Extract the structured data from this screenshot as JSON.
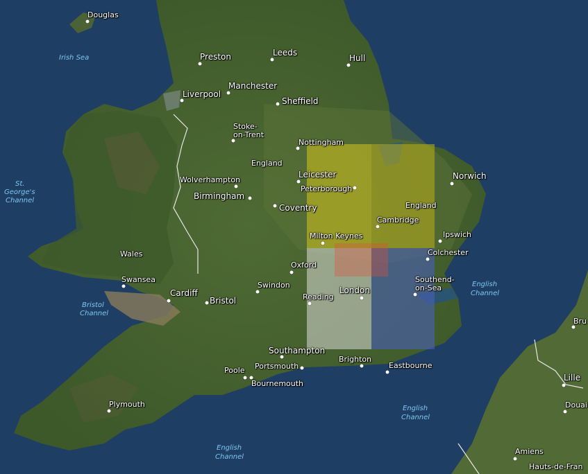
{
  "map": {
    "cities": {
      "douglas": "Douglas",
      "preston": "Preston",
      "leeds": "Leeds",
      "hull": "Hull",
      "liverpool": "Liverpool",
      "manchester": "Manchester",
      "sheffield": "Sheffield",
      "stoke_line1": "Stoke-",
      "stoke_line2": "on-Trent",
      "nottingham": "Nottingham",
      "leicester": "Leicester",
      "peterborough": "Peterborough",
      "norwich": "Norwich",
      "wolverhampton": "Wolverhampton",
      "birmingham": "Birmingham",
      "coventry": "Coventry",
      "cambridge": "Cambridge",
      "milton_keynes": "Milton Keynes",
      "ipswich": "Ipswich",
      "colchester": "Colchester",
      "oxford": "Oxford",
      "swansea": "Swansea",
      "cardiff": "Cardiff",
      "bristol": "Bristol",
      "swindon": "Swindon",
      "reading": "Reading",
      "london": "London",
      "southend_line1": "Southend-",
      "southend_line2": "on-Sea",
      "southampton": "Southampton",
      "brighton": "Brighton",
      "eastbourne": "Eastbourne",
      "portsmouth": "Portsmouth",
      "poole": "Poole",
      "bournemouth": "Bournemouth",
      "plymouth": "Plymouth",
      "lille": "Lille",
      "douai": "Douai",
      "amiens": "Amiens",
      "bru": "Bru"
    },
    "regions": {
      "england": "England",
      "england_east": "England",
      "wales": "Wales",
      "hauts_de_france": "Hauts-de-Fran"
    },
    "water": {
      "irish_sea": "Irish Sea",
      "st_georges_1": "St.",
      "st_georges_2": "George's",
      "st_georges_3": "Channel",
      "bristol_1": "Bristol",
      "bristol_2": "Channel",
      "english_channel_e_1": "English",
      "english_channel_e_2": "Channel",
      "english_channel_s_1": "English",
      "english_channel_s_2": "Channel",
      "english_channel_w_1": "English",
      "english_channel_w_2": "Channel"
    },
    "overlay_colors": {
      "yellow": "#d6c51f",
      "white": "#e8e8e8",
      "blue": "#4a5fb8",
      "red": "#e0503c"
    }
  }
}
